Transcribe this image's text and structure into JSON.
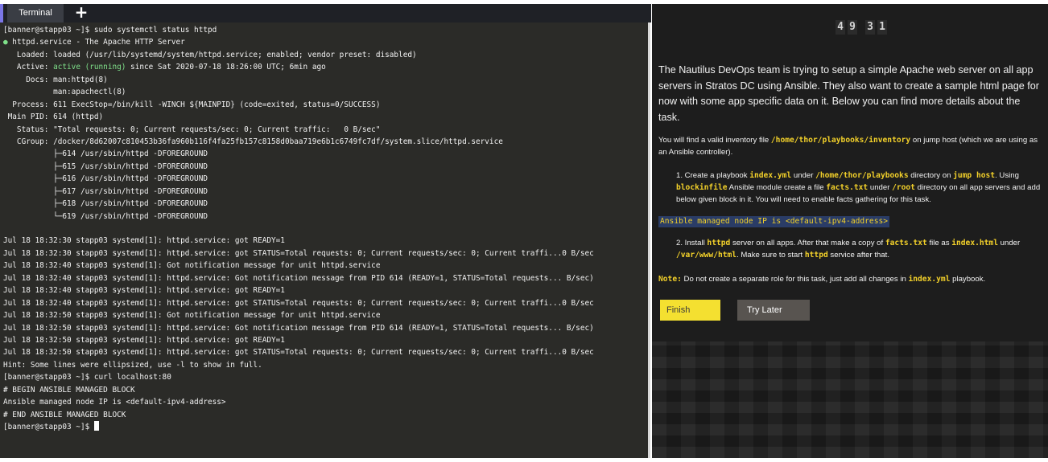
{
  "terminal": {
    "tab_label": "Terminal",
    "add_tab_icon": "plus-icon",
    "lines": [
      "[banner@stapp03 ~]$ sudo systemctl status httpd",
      "● httpd.service - The Apache HTTP Server",
      "   Loaded: loaded (/usr/lib/systemd/system/httpd.service; enabled; vendor preset: disabled)",
      "   Active: active (running) since Sat 2020-07-18 18:26:00 UTC; 6min ago",
      "     Docs: man:httpd(8)",
      "           man:apachectl(8)",
      "  Process: 611 ExecStop=/bin/kill -WINCH ${MAINPID} (code=exited, status=0/SUCCESS)",
      " Main PID: 614 (httpd)",
      "   Status: \"Total requests: 0; Current requests/sec: 0; Current traffic:   0 B/sec\"",
      "   CGroup: /docker/8d62007c810453b36fa960b116f4fa25fb157c8158d0baa719e6b1c6749fc7df/system.slice/httpd.service",
      "           ├─614 /usr/sbin/httpd -DFOREGROUND",
      "           ├─615 /usr/sbin/httpd -DFOREGROUND",
      "           ├─616 /usr/sbin/httpd -DFOREGROUND",
      "           ├─617 /usr/sbin/httpd -DFOREGROUND",
      "           ├─618 /usr/sbin/httpd -DFOREGROUND",
      "           └─619 /usr/sbin/httpd -DFOREGROUND",
      "",
      "Jul 18 18:32:30 stapp03 systemd[1]: httpd.service: got READY=1",
      "Jul 18 18:32:30 stapp03 systemd[1]: httpd.service: got STATUS=Total requests: 0; Current requests/sec: 0; Current traffi...0 B/sec",
      "Jul 18 18:32:40 stapp03 systemd[1]: Got notification message for unit httpd.service",
      "Jul 18 18:32:40 stapp03 systemd[1]: httpd.service: Got notification message from PID 614 (READY=1, STATUS=Total requests... B/sec)",
      "Jul 18 18:32:40 stapp03 systemd[1]: httpd.service: got READY=1",
      "Jul 18 18:32:40 stapp03 systemd[1]: httpd.service: got STATUS=Total requests: 0; Current requests/sec: 0; Current traffi...0 B/sec",
      "Jul 18 18:32:50 stapp03 systemd[1]: Got notification message for unit httpd.service",
      "Jul 18 18:32:50 stapp03 systemd[1]: httpd.service: Got notification message from PID 614 (READY=1, STATUS=Total requests... B/sec)",
      "Jul 18 18:32:50 stapp03 systemd[1]: httpd.service: got READY=1",
      "Jul 18 18:32:50 stapp03 systemd[1]: httpd.service: got STATUS=Total requests: 0; Current requests/sec: 0; Current traffi...0 B/sec",
      "Hint: Some lines were ellipsized, use -l to show in full.",
      "[banner@stapp03 ~]$ curl localhost:80",
      "# BEGIN ANSIBLE MANAGED BLOCK",
      "Ansible managed node IP is <default-ipv4-address>",
      "# END ANSIBLE MANAGED BLOCK"
    ],
    "prompt": "[banner@stapp03 ~]$ ",
    "active_word": "active (running)",
    "status_dot": "●",
    "colors": {
      "background": "#2b2b28",
      "text": "#f2f2f2",
      "active_green": "#7fe08a",
      "tab_accent": "#7b76e6"
    }
  },
  "task": {
    "timer": [
      "4",
      "9",
      "3",
      "1"
    ],
    "intro": "The Nautilus DevOps team is trying to setup a simple Apache web server on all app servers in Stratos DC using Ansible. They also want to create a sample html page for now with some app specific data on it. Below you can find more details about the task.",
    "inventory_pre": "You will find a valid inventory file ",
    "inventory_path": "/home/thor/playbooks/inventory",
    "inventory_post": " on jump host (which we are using as an Ansible controller).",
    "step1": {
      "num": "1.",
      "t1": " Create a playbook ",
      "c1": "index.yml",
      "t2": " under ",
      "c2": "/home/thor/playbooks",
      "t3": " directory on ",
      "c3": "jump host",
      "t4": ". Using ",
      "c4": "blockinfile",
      "t5": " Ansible module create a file ",
      "c5": "facts.txt",
      "t6": " under ",
      "c6": "/root",
      "t7": " directory on all app servers and add below given block in it. You will need to enable facts gathering for this task."
    },
    "code_block": "Ansible managed node IP is <default-ipv4-address>",
    "step2": {
      "num": "2.",
      "t1": " Install ",
      "c1": "httpd",
      "t2": " server on all apps. After that make a copy of ",
      "c2": "facts.txt",
      "t3": " file as ",
      "c3": "index.html",
      "t4": " under ",
      "c4": "/var/www/html",
      "t5": ". Make sure to start ",
      "c5": "httpd",
      "t6": " service after that."
    },
    "note": {
      "label": "Note:",
      "t1": " Do not create a separate role for this task, just add all changes in ",
      "c1": "index.yml",
      "t2": " playbook."
    },
    "buttons": {
      "finish": "Finish",
      "try_later": "Try Later"
    },
    "colors": {
      "accent_yellow": "#f3d12a",
      "finish_bg": "#f4e030",
      "try_later_bg": "#585450",
      "code_block_bg": "#2a3c66"
    }
  }
}
